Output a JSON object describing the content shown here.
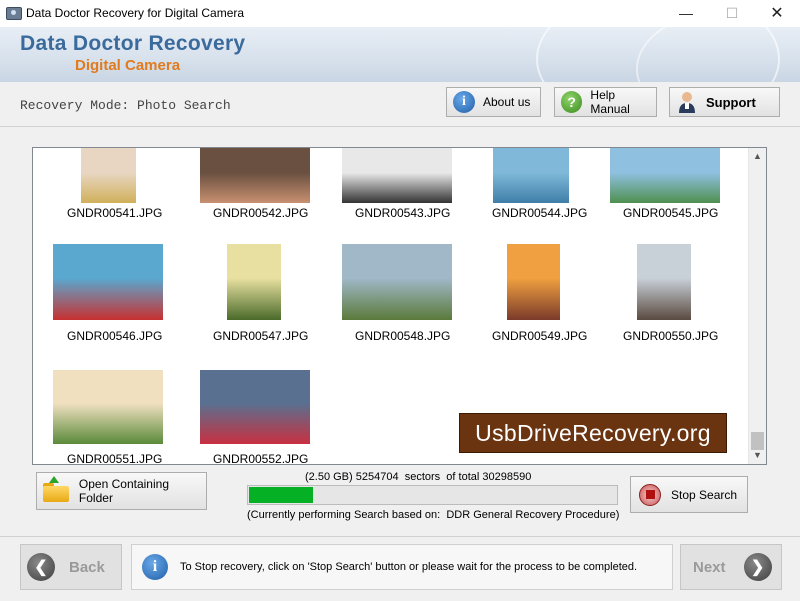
{
  "window": {
    "title": "Data Doctor Recovery for Digital Camera",
    "minimize": "—",
    "maximize": "☐",
    "close": "✕"
  },
  "banner": {
    "line1": "Data Doctor Recovery",
    "line2": "Digital Camera"
  },
  "mode": {
    "label": "Recovery Mode: Photo Search"
  },
  "toolbar": {
    "about": "About us",
    "help": "Help Manual",
    "support": "Support"
  },
  "files": [
    {
      "name": "GNDR00541.JPG",
      "colors": [
        "#e8d6c2",
        "#d0b05a"
      ]
    },
    {
      "name": "GNDR00542.JPG",
      "colors": [
        "#6a5040",
        "#c89070"
      ]
    },
    {
      "name": "GNDR00543.JPG",
      "colors": [
        "#e8e8e8",
        "#333333"
      ]
    },
    {
      "name": "GNDR00544.JPG",
      "colors": [
        "#7fb8d8",
        "#3f7fa8"
      ]
    },
    {
      "name": "GNDR00545.JPG",
      "colors": [
        "#8fc0e0",
        "#4f8f4f"
      ]
    },
    {
      "name": "GNDR00546.JPG",
      "colors": [
        "#5aa8d0",
        "#c83030"
      ]
    },
    {
      "name": "GNDR00547.JPG",
      "colors": [
        "#e8e0a0",
        "#4a6a2a"
      ]
    },
    {
      "name": "GNDR00548.JPG",
      "colors": [
        "#a0b8c8",
        "#5a7a3a"
      ]
    },
    {
      "name": "GNDR00549.JPG",
      "colors": [
        "#f0a040",
        "#7a3a2a"
      ]
    },
    {
      "name": "GNDR00550.JPG",
      "colors": [
        "#c8d0d8",
        "#5a4a40"
      ]
    },
    {
      "name": "GNDR00551.JPG",
      "colors": [
        "#f0e0c0",
        "#5a8a3a"
      ]
    },
    {
      "name": "GNDR00552.JPG",
      "colors": [
        "#5a7090",
        "#c83040"
      ]
    }
  ],
  "watermark": "UsbDriveRecovery.org",
  "actions": {
    "open_folder": "Open Containing Folder",
    "stop_search": "Stop Search"
  },
  "progress": {
    "size": "(2.50 GB)",
    "sectors_done": "5254704",
    "sectors_word": "sectors",
    "of_total": "of  total",
    "sectors_total": "30298590",
    "fraction": 0.1734,
    "method_prefix": "(Currently performing Search based on:",
    "method": "DDR General Recovery Procedure)"
  },
  "footer": {
    "back": "Back",
    "next": "Next",
    "status": "To Stop recovery, click on 'Stop Search' button or please wait for the process to be completed."
  },
  "icons": {
    "info": "i",
    "help": "?",
    "back_arrow": "❮",
    "next_arrow": "❯"
  }
}
